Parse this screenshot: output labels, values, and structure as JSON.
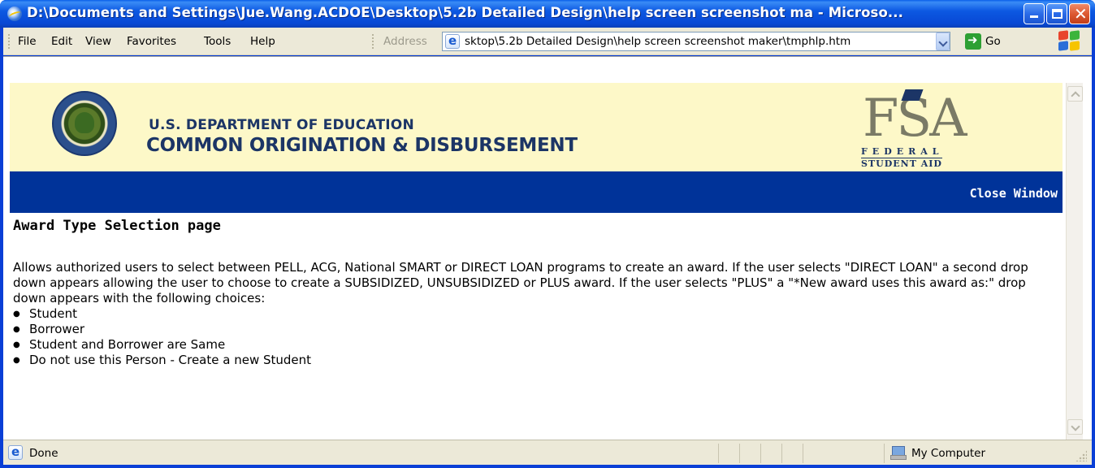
{
  "window": {
    "title": "D:\\Documents and Settings\\Jue.Wang.ACDOE\\Desktop\\5.2b Detailed Design\\help screen screenshot ma - Microso..."
  },
  "menu": {
    "items": [
      "File",
      "Edit",
      "View",
      "Favorites",
      "Tools",
      "Help"
    ]
  },
  "address_bar": {
    "label": "Address",
    "value": "sktop\\5.2b Detailed Design\\help screen screenshot maker\\tmphlp.htm",
    "go_label": "Go"
  },
  "header": {
    "department": "U.S. DEPARTMENT OF EDUCATION",
    "system_name": "COMMON ORIGINATION & DISBURSEMENT",
    "fsa_logo": {
      "letters": "FSA",
      "line1": "FEDERAL",
      "line2": "STUDENT AID"
    }
  },
  "nav": {
    "close_window": "Close Window"
  },
  "content": {
    "heading": "Award Type Selection page",
    "paragraph": "Allows authorized users to select between PELL, ACG, National SMART or DIRECT LOAN programs to create an award. If the user selects \"DIRECT LOAN\" a second drop down appears allowing the user to choose to create a SUBSIDIZED, UNSUBSIDIZED or PLUS award. If the user selects \"PLUS\" a \"*New award uses this award as:\" drop down appears with the following choices:",
    "bullets": [
      "Student",
      "Borrower",
      "Student and Borrower are Same",
      "Do not use this Person - Create a new Student"
    ]
  },
  "status_bar": {
    "status": "Done",
    "zone": "My Computer"
  },
  "colors": {
    "title_bar": "#0848d4",
    "header_band": "#fdf8c8",
    "nav_bar": "#003399",
    "dept_text": "#1c3566"
  },
  "icons": [
    "ie-icon",
    "minimize-icon",
    "maximize-icon",
    "close-icon",
    "ie-page-icon",
    "dropdown-arrow-icon",
    "go-arrow-icon",
    "windows-logo-icon",
    "seal-logo",
    "fsa-logo",
    "computer-icon",
    "resize-grip-icon"
  ]
}
